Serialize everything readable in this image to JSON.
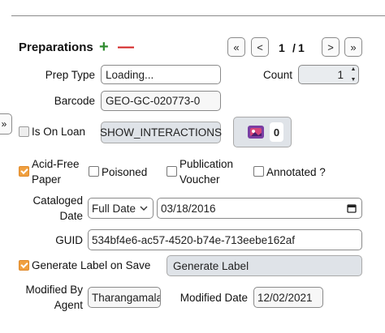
{
  "header": {
    "title": "Preparations",
    "add_symbol": "+",
    "remove_symbol": "—",
    "pager": {
      "first": "«",
      "prev": "<",
      "current": "1",
      "separator": "/",
      "total": "1",
      "next": ">",
      "last": "»"
    }
  },
  "side_toggle": "»",
  "fields": {
    "prep_type": {
      "label": "Prep Type",
      "value": "Loading..."
    },
    "count": {
      "label": "Count",
      "value": "1"
    },
    "barcode": {
      "label": "Barcode",
      "value": "GEO-GC-020773-0"
    },
    "is_on_loan": {
      "label": "Is On Loan",
      "checked": false
    },
    "show_interactions": {
      "label": "SHOW_INTERACTIONS"
    },
    "attachments": {
      "count": "0",
      "icon": "attachment-icon"
    },
    "acid_free": {
      "label_line1": "Acid-Free",
      "label_line2": "Paper",
      "checked": true
    },
    "poisoned": {
      "label": "Poisoned",
      "checked": false
    },
    "publication_voucher": {
      "label_line1": "Publication",
      "label_line2": "Voucher",
      "checked": false
    },
    "annotated": {
      "label": "Annotated ?",
      "checked": false
    },
    "cataloged_date": {
      "label_line1": "Cataloged",
      "label_line2": "Date",
      "precision": "Full Date",
      "value": "03/18/2016"
    },
    "guid": {
      "label": "GUID",
      "value": "534bf4e6-ac57-4520-b74e-713eebe162af"
    },
    "generate_label": {
      "label": "Generate Label on Save",
      "checked": true,
      "button": "Generate Label"
    },
    "modified_by": {
      "label_line1": "Modified By",
      "label_line2": "Agent",
      "value": "Tharangamala"
    },
    "modified_date": {
      "label": "Modified Date",
      "value": "12/02/2021"
    }
  },
  "colors": {
    "accent_checkbox": "#f0a040",
    "add": "#2e8b2e",
    "remove": "#d21f1f"
  }
}
